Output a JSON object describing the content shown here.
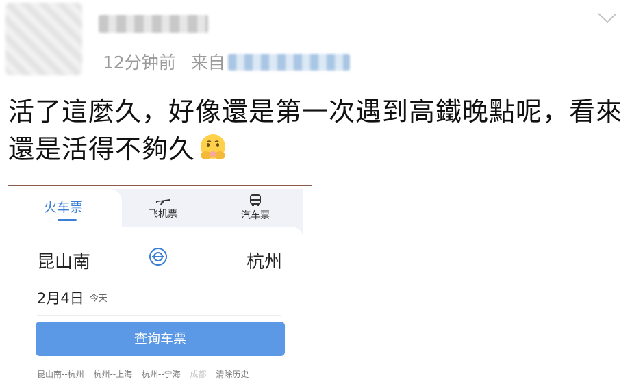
{
  "post": {
    "time": "12分钟前",
    "from_label": "来自",
    "text": "活了這麼久，好像還是第一次遇到高鐵晚點呢，看來還是活得不夠久",
    "emoji": "face-with-hand-over-mouth-icon"
  },
  "card": {
    "tabs": [
      {
        "label": "火车票",
        "active": true
      },
      {
        "label": "飞机票",
        "icon": "plane-icon"
      },
      {
        "label": "汽车票",
        "icon": "bus-icon"
      }
    ],
    "from_station": "昆山南",
    "to_station": "杭州",
    "date": "2月4日",
    "date_note": "今天",
    "search_button": "查询车票",
    "history": [
      "昆山南--杭州",
      "杭州--上海",
      "杭州--宁海",
      "成都"
    ],
    "clear_history": "清除历史",
    "accent_color": "#3a7fd5"
  }
}
